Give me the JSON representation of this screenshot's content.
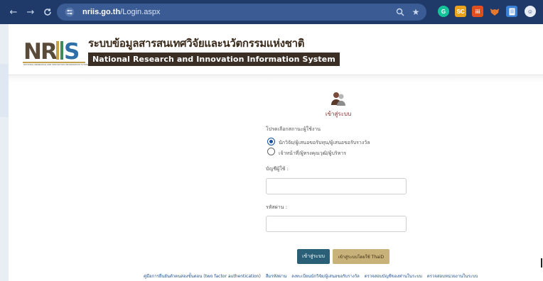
{
  "browser": {
    "url_domain": "nriis.go.th",
    "url_path": "/Login.aspx",
    "icons": [
      "back-icon",
      "forward-icon",
      "reload-icon",
      "site-settings-icon",
      "zoom-icon",
      "bookmark-star-icon"
    ],
    "extensions": [
      {
        "name": "grammarly-extension-icon",
        "label": "G",
        "color": "#15c39a"
      },
      {
        "name": "extension-sc-icon",
        "label": "SC",
        "color": "#e8a21b"
      },
      {
        "name": "extension-grid-icon",
        "label": "iii",
        "color": "#e04f1d"
      },
      {
        "name": "extension-fox-icon",
        "label": "🦊",
        "color": "#1f3a68"
      },
      {
        "name": "extension-doc-icon",
        "label": "▤",
        "color": "#3b82d6"
      },
      {
        "name": "profile-icon",
        "label": "☺",
        "color": "#1f3a68"
      }
    ]
  },
  "header": {
    "logo_text": "NRIIS",
    "logo_subtext": "NATIONAL RESEARCH AND INNOVATION INFORMATION SYSTEM",
    "title_th": "ระบบข้อมูลสารสนเทศวิจัยและนวัตกรรมแห่งชาติ",
    "title_en": "National Research and Innovation Information System"
  },
  "login": {
    "heading": "เข้าสู่ระบบ",
    "user_type_label": "โปรดเลือกสถานะผู้ใช้งาน",
    "options": [
      {
        "label": "นักวิจัย/ผู้เสนอขอรับทุน/ผู้เสนอขอรับรางวัล",
        "selected": true
      },
      {
        "label": "เจ้าหน้าที่/ผู้ทรงคุณวุฒิ/ผู้บริหาร",
        "selected": false
      }
    ],
    "username_label": "บัญชีผู้ใช้ :",
    "username_value": "",
    "password_label": "รหัสผ่าน :",
    "password_value": "",
    "login_button": "เข้าสู่ระบบ",
    "thaid_button": "เข้าสู่ระบบโดยใช้ ThaiD"
  },
  "footer_links": [
    "คู่มือการยืนยันตัวตนสองขั้นตอน (two factor authentication)",
    "ลืมรหัสผ่าน",
    "ลงทะเบียนนักวิจัย/ผู้เสนอขอรับรางวัล",
    "ตรวจสอบบัญชีของท่านในระบบ",
    "ตรวจสอบหน่วยงานในระบบ"
  ],
  "colors": {
    "browser_bg": "#1f3a68",
    "heading_red": "#8a2a2a",
    "login_button": "#2a5f78",
    "thaid_button": "#c9b27a",
    "link_blue": "#1f4f8f"
  }
}
